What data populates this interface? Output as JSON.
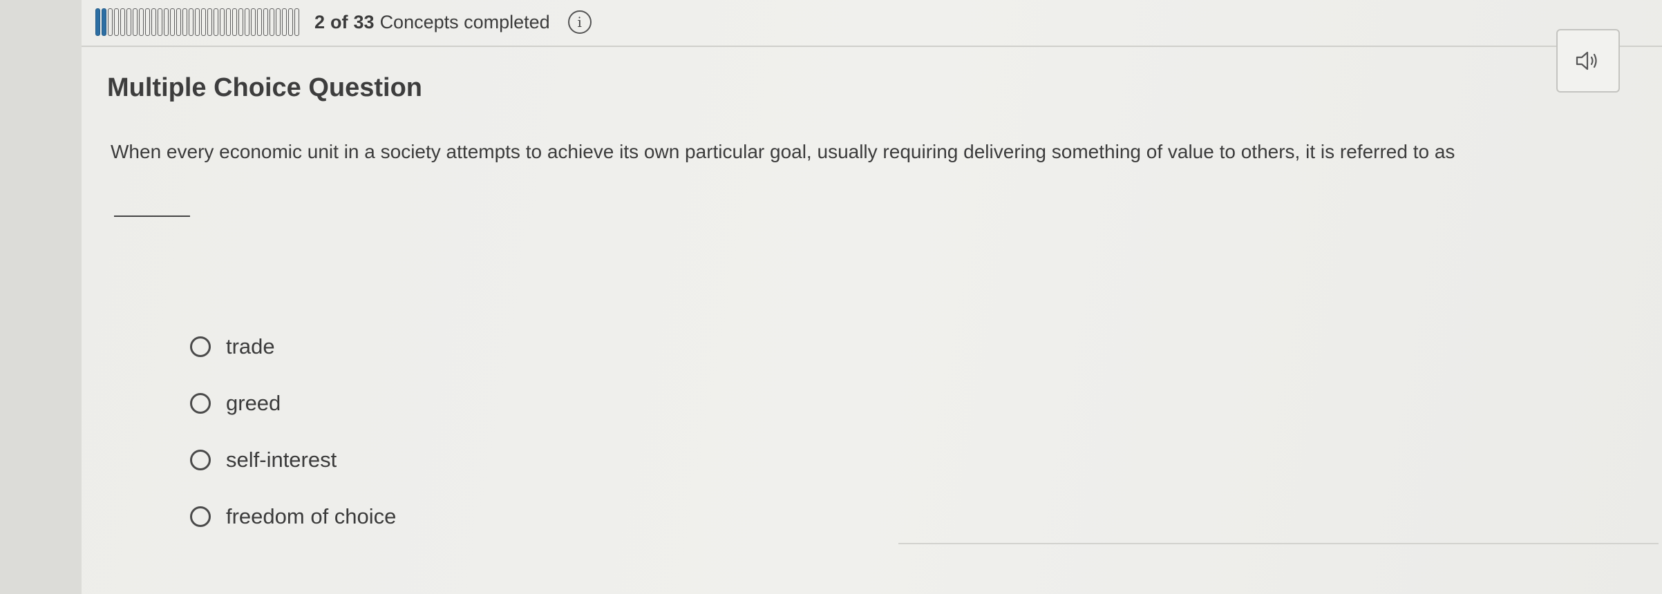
{
  "progress": {
    "completed": "2",
    "of_label": "of",
    "total": "33",
    "suffix": "Concepts completed",
    "filled_segments": 2,
    "total_segments": 33
  },
  "question": {
    "type_label": "Multiple Choice Question",
    "prompt": "When every economic unit in a society attempts to achieve its own particular goal, usually requiring delivering something of value to others, it is referred to as",
    "blank_suffix": "."
  },
  "options": [
    {
      "label": "trade"
    },
    {
      "label": "greed"
    },
    {
      "label": "self-interest"
    },
    {
      "label": "freedom of choice"
    }
  ],
  "icons": {
    "info": "info-icon",
    "audio": "speaker-icon"
  }
}
